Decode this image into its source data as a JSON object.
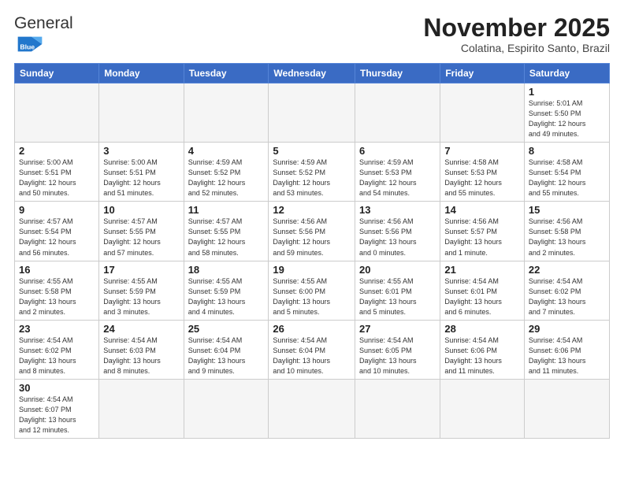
{
  "logo": {
    "text_general": "General",
    "text_blue": "Blue"
  },
  "title": "November 2025",
  "subtitle": "Colatina, Espirito Santo, Brazil",
  "weekdays": [
    "Sunday",
    "Monday",
    "Tuesday",
    "Wednesday",
    "Thursday",
    "Friday",
    "Saturday"
  ],
  "weeks": [
    [
      {
        "day": "",
        "info": ""
      },
      {
        "day": "",
        "info": ""
      },
      {
        "day": "",
        "info": ""
      },
      {
        "day": "",
        "info": ""
      },
      {
        "day": "",
        "info": ""
      },
      {
        "day": "",
        "info": ""
      },
      {
        "day": "1",
        "info": "Sunrise: 5:01 AM\nSunset: 5:50 PM\nDaylight: 12 hours\nand 49 minutes."
      }
    ],
    [
      {
        "day": "2",
        "info": "Sunrise: 5:00 AM\nSunset: 5:51 PM\nDaylight: 12 hours\nand 50 minutes."
      },
      {
        "day": "3",
        "info": "Sunrise: 5:00 AM\nSunset: 5:51 PM\nDaylight: 12 hours\nand 51 minutes."
      },
      {
        "day": "4",
        "info": "Sunrise: 4:59 AM\nSunset: 5:52 PM\nDaylight: 12 hours\nand 52 minutes."
      },
      {
        "day": "5",
        "info": "Sunrise: 4:59 AM\nSunset: 5:52 PM\nDaylight: 12 hours\nand 53 minutes."
      },
      {
        "day": "6",
        "info": "Sunrise: 4:59 AM\nSunset: 5:53 PM\nDaylight: 12 hours\nand 54 minutes."
      },
      {
        "day": "7",
        "info": "Sunrise: 4:58 AM\nSunset: 5:53 PM\nDaylight: 12 hours\nand 55 minutes."
      },
      {
        "day": "8",
        "info": "Sunrise: 4:58 AM\nSunset: 5:54 PM\nDaylight: 12 hours\nand 55 minutes."
      }
    ],
    [
      {
        "day": "9",
        "info": "Sunrise: 4:57 AM\nSunset: 5:54 PM\nDaylight: 12 hours\nand 56 minutes."
      },
      {
        "day": "10",
        "info": "Sunrise: 4:57 AM\nSunset: 5:55 PM\nDaylight: 12 hours\nand 57 minutes."
      },
      {
        "day": "11",
        "info": "Sunrise: 4:57 AM\nSunset: 5:55 PM\nDaylight: 12 hours\nand 58 minutes."
      },
      {
        "day": "12",
        "info": "Sunrise: 4:56 AM\nSunset: 5:56 PM\nDaylight: 12 hours\nand 59 minutes."
      },
      {
        "day": "13",
        "info": "Sunrise: 4:56 AM\nSunset: 5:56 PM\nDaylight: 13 hours\nand 0 minutes."
      },
      {
        "day": "14",
        "info": "Sunrise: 4:56 AM\nSunset: 5:57 PM\nDaylight: 13 hours\nand 1 minute."
      },
      {
        "day": "15",
        "info": "Sunrise: 4:56 AM\nSunset: 5:58 PM\nDaylight: 13 hours\nand 2 minutes."
      }
    ],
    [
      {
        "day": "16",
        "info": "Sunrise: 4:55 AM\nSunset: 5:58 PM\nDaylight: 13 hours\nand 2 minutes."
      },
      {
        "day": "17",
        "info": "Sunrise: 4:55 AM\nSunset: 5:59 PM\nDaylight: 13 hours\nand 3 minutes."
      },
      {
        "day": "18",
        "info": "Sunrise: 4:55 AM\nSunset: 5:59 PM\nDaylight: 13 hours\nand 4 minutes."
      },
      {
        "day": "19",
        "info": "Sunrise: 4:55 AM\nSunset: 6:00 PM\nDaylight: 13 hours\nand 5 minutes."
      },
      {
        "day": "20",
        "info": "Sunrise: 4:55 AM\nSunset: 6:01 PM\nDaylight: 13 hours\nand 5 minutes."
      },
      {
        "day": "21",
        "info": "Sunrise: 4:54 AM\nSunset: 6:01 PM\nDaylight: 13 hours\nand 6 minutes."
      },
      {
        "day": "22",
        "info": "Sunrise: 4:54 AM\nSunset: 6:02 PM\nDaylight: 13 hours\nand 7 minutes."
      }
    ],
    [
      {
        "day": "23",
        "info": "Sunrise: 4:54 AM\nSunset: 6:02 PM\nDaylight: 13 hours\nand 8 minutes."
      },
      {
        "day": "24",
        "info": "Sunrise: 4:54 AM\nSunset: 6:03 PM\nDaylight: 13 hours\nand 8 minutes."
      },
      {
        "day": "25",
        "info": "Sunrise: 4:54 AM\nSunset: 6:04 PM\nDaylight: 13 hours\nand 9 minutes."
      },
      {
        "day": "26",
        "info": "Sunrise: 4:54 AM\nSunset: 6:04 PM\nDaylight: 13 hours\nand 10 minutes."
      },
      {
        "day": "27",
        "info": "Sunrise: 4:54 AM\nSunset: 6:05 PM\nDaylight: 13 hours\nand 10 minutes."
      },
      {
        "day": "28",
        "info": "Sunrise: 4:54 AM\nSunset: 6:06 PM\nDaylight: 13 hours\nand 11 minutes."
      },
      {
        "day": "29",
        "info": "Sunrise: 4:54 AM\nSunset: 6:06 PM\nDaylight: 13 hours\nand 11 minutes."
      }
    ],
    [
      {
        "day": "30",
        "info": "Sunrise: 4:54 AM\nSunset: 6:07 PM\nDaylight: 13 hours\nand 12 minutes."
      },
      {
        "day": "",
        "info": ""
      },
      {
        "day": "",
        "info": ""
      },
      {
        "day": "",
        "info": ""
      },
      {
        "day": "",
        "info": ""
      },
      {
        "day": "",
        "info": ""
      },
      {
        "day": "",
        "info": ""
      }
    ]
  ]
}
